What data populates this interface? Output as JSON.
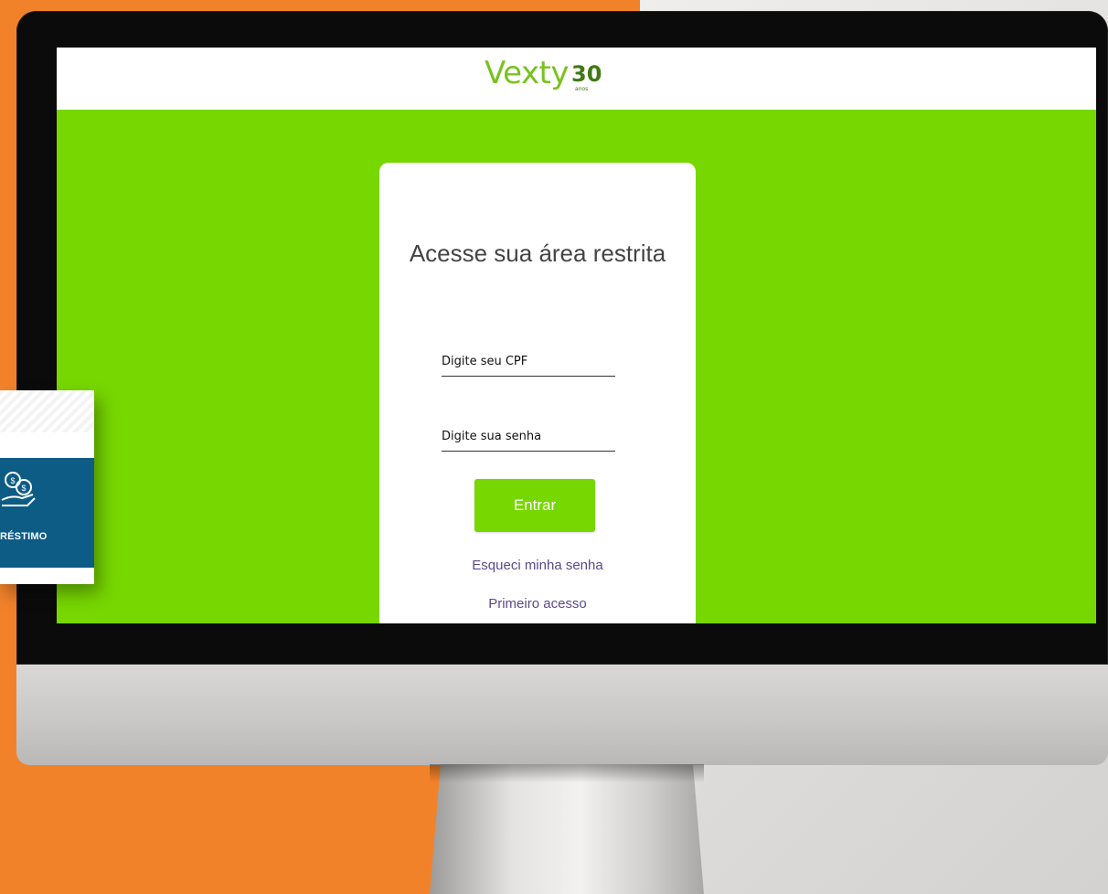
{
  "logo": {
    "word": "Vexty",
    "number": "30",
    "number_sub": "anos"
  },
  "login": {
    "title": "Acesse sua área restrita",
    "cpf_label": "Digite seu CPF",
    "password_label": "Digite sua senha",
    "submit_label": "Entrar",
    "forgot_link": "Esqueci minha senha",
    "first_access_link": "Primeiro acesso"
  },
  "side_card": {
    "label": "RÉSTIMO",
    "icon": "coins-hand-icon"
  },
  "colors": {
    "screen_green": "#77d700",
    "logo_green": "#78c21f",
    "link_purple": "#5a4a8a",
    "panel_blue": "#0d5c86",
    "background_orange": "#f2822a"
  }
}
